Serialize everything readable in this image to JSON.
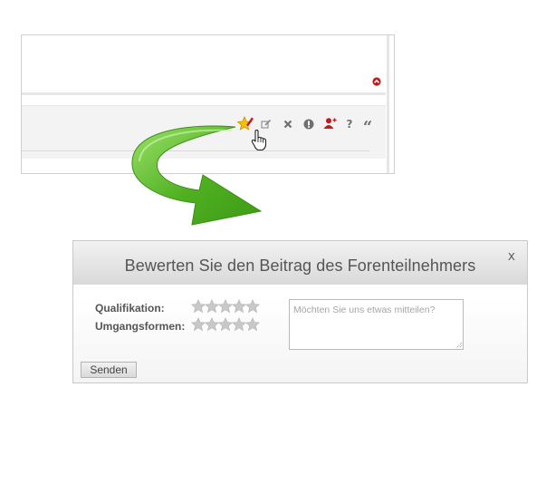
{
  "post": {
    "scroll_up_icon": "chevron-up-circle-icon",
    "actions": [
      {
        "icon": "star-rating-icon",
        "label": "Bewerten"
      },
      {
        "icon": "edit-icon"
      },
      {
        "icon": "close-icon"
      },
      {
        "icon": "alert-icon"
      },
      {
        "icon": "add-user-icon"
      },
      {
        "icon": "help-question-icon"
      },
      {
        "icon": "quote-icon"
      }
    ],
    "cursor": "hand-pointer-icon"
  },
  "dialog": {
    "title": "Bewerten Sie den Beitrag des Forenteilnehmers",
    "close_label": "x",
    "ratings": [
      {
        "label": "Qualifikation:",
        "stars": 5,
        "value": 0
      },
      {
        "label": "Umgangsformen:",
        "stars": 5,
        "value": 0
      }
    ],
    "comment_placeholder": "Möchten Sie uns etwas mitteilen?",
    "comment_value": "",
    "submit_label": "Senden"
  },
  "colors": {
    "accent_red": "#c01b1b",
    "arrow_green": "#59b32a",
    "star_empty": "#c8c8c8"
  }
}
